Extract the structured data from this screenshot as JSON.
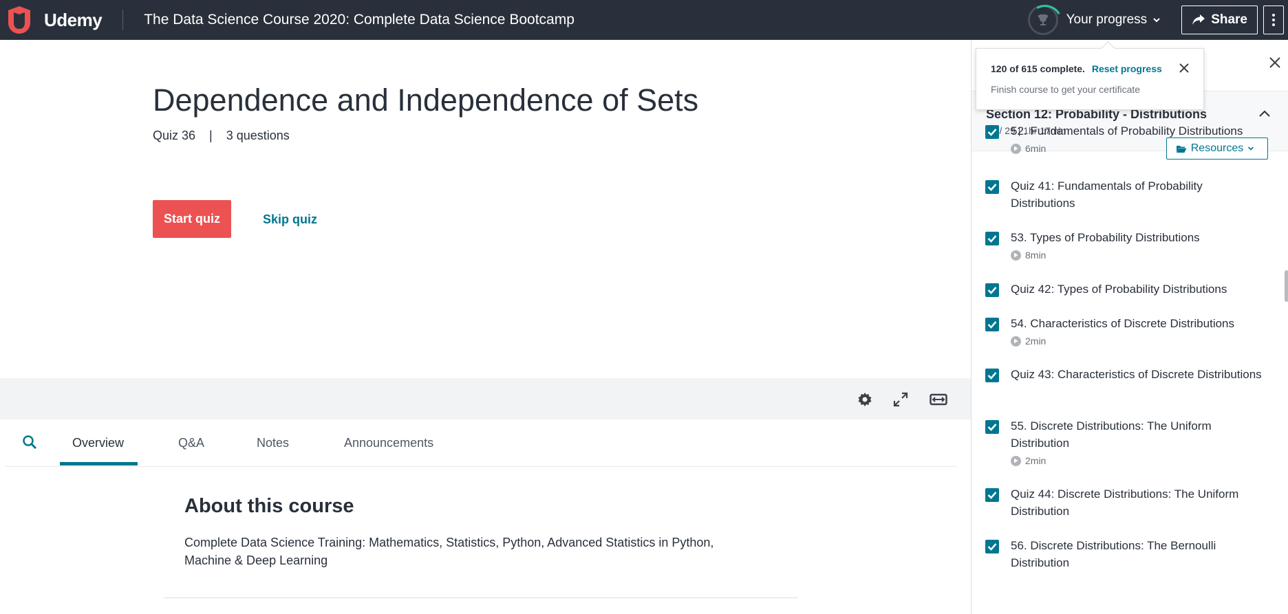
{
  "header": {
    "brand": "Udemy",
    "course_title": "The Data Science Course 2020: Complete Data Science Bootcamp",
    "progress_label": "Your progress",
    "share_label": "Share"
  },
  "progress_popover": {
    "complete_text": "120 of 615 complete.",
    "reset_label": "Reset progress",
    "subtext": "Finish course to get your certificate"
  },
  "lecture": {
    "title": "Dependence and Independence of Sets",
    "quiz_label": "Quiz 36",
    "separator": "|",
    "questions": "3 questions",
    "start_label": "Start quiz",
    "skip_label": "Skip quiz"
  },
  "tabs": [
    "Overview",
    "Q&A",
    "Notes",
    "Announcements"
  ],
  "about": {
    "title": "About this course",
    "description": "Complete Data Science Training: Mathematics, Statistics, Python, Advanced Statistics in Python, Machine & Deep Learning"
  },
  "sidebar": {
    "section_title": "Section 12: Probability - Distributions",
    "section_sub": "29 / 29 | 1hr 17min",
    "resources_label": "Resources",
    "items": [
      {
        "title": "52. Fundamentals of Probability Distributions",
        "duration": "6min",
        "checked": true
      },
      {
        "title": "Quiz 41: Fundamentals of Probability Distributions",
        "duration": "",
        "checked": true
      },
      {
        "title": "53. Types of Probability Distributions",
        "duration": "8min",
        "checked": true
      },
      {
        "title": "Quiz 42: Types of Probability Distributions",
        "duration": "",
        "checked": true
      },
      {
        "title": "54. Characteristics of Discrete Distributions",
        "duration": "2min",
        "checked": true
      },
      {
        "title": "Quiz 43: Characteristics of Discrete Distributions",
        "duration": "",
        "checked": true
      },
      {
        "title": "55. Discrete Distributions: The Uniform Distribution",
        "duration": "2min",
        "checked": true
      },
      {
        "title": "Quiz 44: Discrete Distributions: The Uniform Distribution",
        "duration": "",
        "checked": true
      },
      {
        "title": "56. Discrete Distributions: The Bernoulli Distribution",
        "duration": "",
        "checked": true
      }
    ]
  },
  "colors": {
    "header_bg": "#29303b",
    "accent": "#007791",
    "start_button": "#ec5252"
  }
}
